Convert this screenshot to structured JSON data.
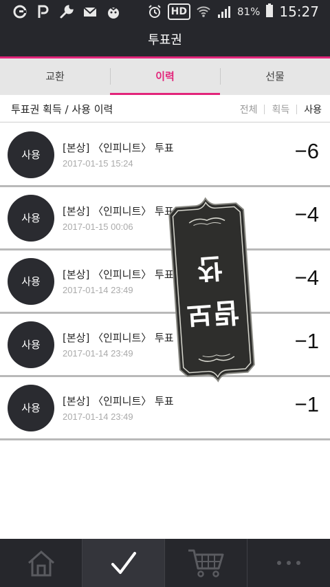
{
  "statusbar": {
    "left_icons": [
      "olleh-icon",
      "p-icon",
      "wrench-icon",
      "mail-icon",
      "tomato-icon"
    ],
    "right_icons": [
      "alarm-icon",
      "hd-icon",
      "wifi-icon",
      "signal-icon"
    ],
    "hd_label": "HD",
    "battery": "81%",
    "time": "15:27"
  },
  "header": {
    "title": "투표권"
  },
  "tabs": [
    {
      "label": "교환",
      "active": false
    },
    {
      "label": "이력",
      "active": true
    },
    {
      "label": "선물",
      "active": false
    }
  ],
  "subheader": {
    "title": "투표권 획득 / 사용 이력",
    "filters": [
      {
        "label": "전체",
        "active": false
      },
      {
        "label": "획득",
        "active": false
      },
      {
        "label": "사용",
        "active": true
      }
    ]
  },
  "history": [
    {
      "badge": "사용",
      "title": "[본상] 〈인피니트〉 투표",
      "date": "2017-01-15 15:24",
      "amount": "−6"
    },
    {
      "badge": "사용",
      "title": "[본상] 〈인피니트〉 투표",
      "date": "2017-01-15 00:06",
      "amount": "−4"
    },
    {
      "badge": "사용",
      "title": "[본상] 〈인피니트〉 투표",
      "date": "2017-01-14 23:49",
      "amount": "−4"
    },
    {
      "badge": "사용",
      "title": "[본상] 〈인피니트〉 투표",
      "date": "2017-01-14 23:49",
      "amount": "−1"
    },
    {
      "badge": "사용",
      "title": "[본상] 〈인피니트〉 투표",
      "date": "2017-01-14 23:49",
      "amount": "−1"
    }
  ],
  "stamp": {
    "text": "보람찬"
  },
  "bottomnav": [
    {
      "icon": "home-icon",
      "active": false
    },
    {
      "icon": "check-icon",
      "active": true
    },
    {
      "icon": "cart-icon",
      "active": false
    },
    {
      "icon": "more-icon",
      "active": false
    }
  ],
  "colors": {
    "accent": "#e2247a",
    "dark": "#26272c",
    "badge": "#2a2b30"
  }
}
